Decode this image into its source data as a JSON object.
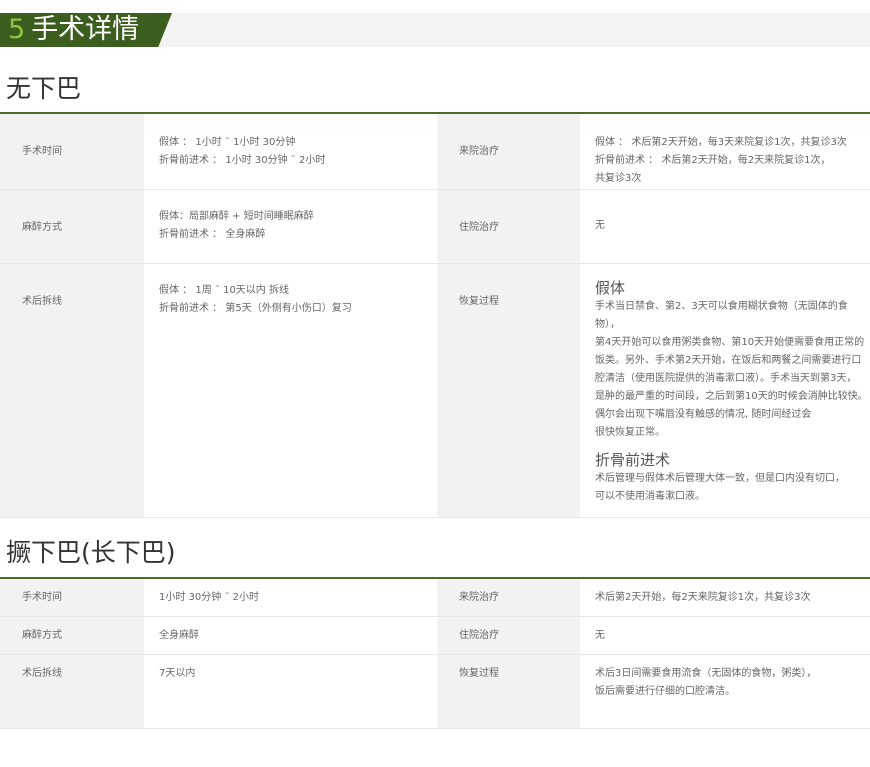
{
  "header": {
    "number": "5",
    "title": "手术详情"
  },
  "section1": {
    "title": "无下巴",
    "rows": [
      {
        "left_label": "手术时间",
        "left_lines": [
          "假体 ： 1小时 ˜ 1小时 30分钟",
          "折骨前进术 ： 1小时 30分钟 ˜ 2小时"
        ],
        "right_label": "来院治疗",
        "right_lines": [
          "假体 ： 术后第2天开始，每3天来院复诊1次，共复诊3次",
          "折骨前进术 ： 术后第2天开始，每2天来院复诊1次，",
          "共复诊3次"
        ]
      },
      {
        "left_label": "麻醉方式",
        "left_lines": [
          "假体：局部麻醉 + 短时间睡眠麻醉",
          "折骨前进术 ： 全身麻醉"
        ],
        "right_label": "住院治疗",
        "right_lines": [
          "无"
        ]
      },
      {
        "left_label": "术后拆线",
        "left_lines": [
          "假体 ： 1周 ˜ 10天以内 拆线",
          "折骨前进术 ： 第5天（外侧有小伤口）复习"
        ],
        "right_label": "恢复过程",
        "recovery": {
          "heading1": "假体",
          "para1": [
            "手术当日禁食、第2、3天可以食用糊状食物（无固体的食物），",
            "第4天开始可以食用粥类食物、第10天开始便需要食用正常的",
            "饭类。另外、手术第2天开始，在饭后和两餐之间需要进行口",
            "腔清洁（使用医院提供的消毒漱口液）。手术当天到第3天，",
            "是肿的最严重的时间段，之后到第10天的时候会消肿比较快。",
            "偶尔会出现下嘴唇没有触感的情况, 随时间经过会",
            "很快恢复正常。"
          ],
          "heading2": "折骨前进术",
          "para2": [
            "术后管理与假体术后管理大体一致，但是口内没有切口，",
            "可以不使用消毒漱口液。"
          ]
        }
      }
    ]
  },
  "section2": {
    "title": "撅下巴(长下巴)",
    "rows": [
      {
        "left_label": "手术时间",
        "left_lines": [
          "1小时 30分钟 ˜ 2小时"
        ],
        "right_label": "来院治疗",
        "right_lines": [
          "术后第2天开始，每2天来院复诊1次，共复诊3次"
        ]
      },
      {
        "left_label": "麻醉方式",
        "left_lines": [
          "全身麻醉"
        ],
        "right_label": "住院治疗",
        "right_lines": [
          "无"
        ]
      },
      {
        "left_label": "术后拆线",
        "left_lines": [
          "7天以内"
        ],
        "right_label": "恢复过程",
        "right_lines": [
          "术后3日间需要食用流食（无固体的食物，粥类），",
          "饭后需要进行仔细的口腔清洁。"
        ]
      }
    ]
  }
}
